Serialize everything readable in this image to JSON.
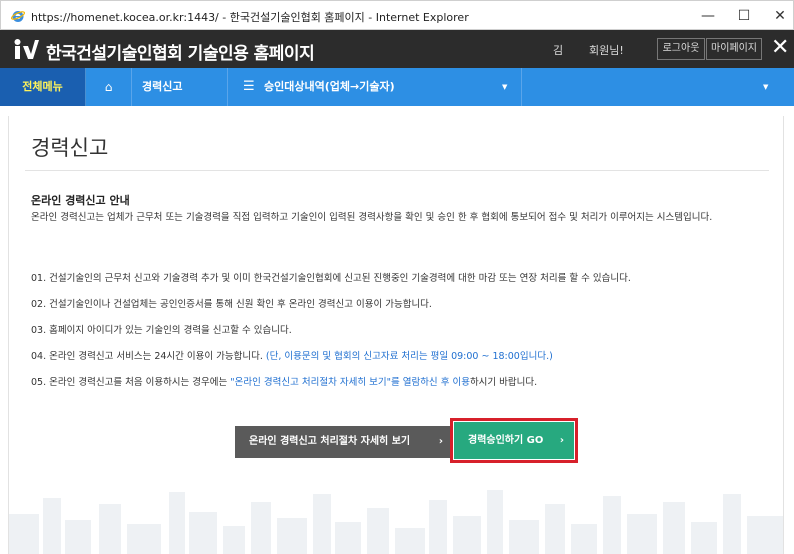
{
  "window": {
    "title": "https://homenet.kocea.or.kr:1443/ - 한국건설기술인협회 홈페이지 - Internet Explorer",
    "min_label": "—",
    "max_label": "☐",
    "close_label": "✕",
    "icon": "internet-explorer-icon"
  },
  "header": {
    "site_title": "한국건설기술인협회 기술인용 홈페이지",
    "user_name": "김",
    "user_suffix": "회원님!",
    "logout_label": "로그아웃",
    "mypage_label": "마이페이지",
    "close_label": "✕",
    "logo_icon": "kocea-logo-icon"
  },
  "nav": {
    "all_menu": "전체메뉴",
    "home_icon": "⌂",
    "career": "경력신고",
    "menu_icon": "☰",
    "approval": "승인대상내역(업체→기술자)",
    "dropdown_arrow": "▼",
    "accent_color": "#2d8fe4",
    "all_menu_color": "#fff35b"
  },
  "main": {
    "page_title": "경력신고",
    "section_heading": "온라인 경력신고 안내",
    "section_desc": "온라인 경력신고는 업체가 근무처 또는 기술경력을 직접 입력하고 기술인이 입력된 경력사항을 확인 및 승인 한 후 협회에 통보되어 접수 및 처리가 이루어지는 시스템입니다.",
    "notices": {
      "n1": "01. 건설기술인의 근무처 신고와 기술경력 추가 및 이미 한국건설기술인협회에 신고된 진행중인 기술경력에 대한 마감 또는 연장 처리를 할 수 있습니다.",
      "n2": "02. 건설기술인이나 건설업체는 공인인증서를 통해 신원 확인 후 온라인 경력신고 이용이 가능합니다.",
      "n3": "03. 홈페이지 아이디가 있는 기술인의 경력을 신고할 수 있습니다.",
      "n4_prefix": "04. 온라인 경력신고 서비스는 24시간 이용이 가능합니다. ",
      "n4_highlight": "(단, 이용문의 및 협회의 신고자료 처리는 평일 09:00 ~ 18:00입니다.)",
      "n5_prefix": "05. 온라인 경력신고를 처음 이용하시는 경우에는 ",
      "n5_highlight": "\"온라인 경력신고 처리절차 자세히 보기\"를 열람하신 후 이용",
      "n5_suffix": "하시기 바랍니다."
    },
    "detail_button": "온라인 경력신고 처리절차 자세히 보기",
    "go_button": "경력승인하기 GO",
    "chevron": "›",
    "highlight_color": "#1f6fd0",
    "go_color": "#27a97f",
    "frame_color": "#d7202a"
  }
}
